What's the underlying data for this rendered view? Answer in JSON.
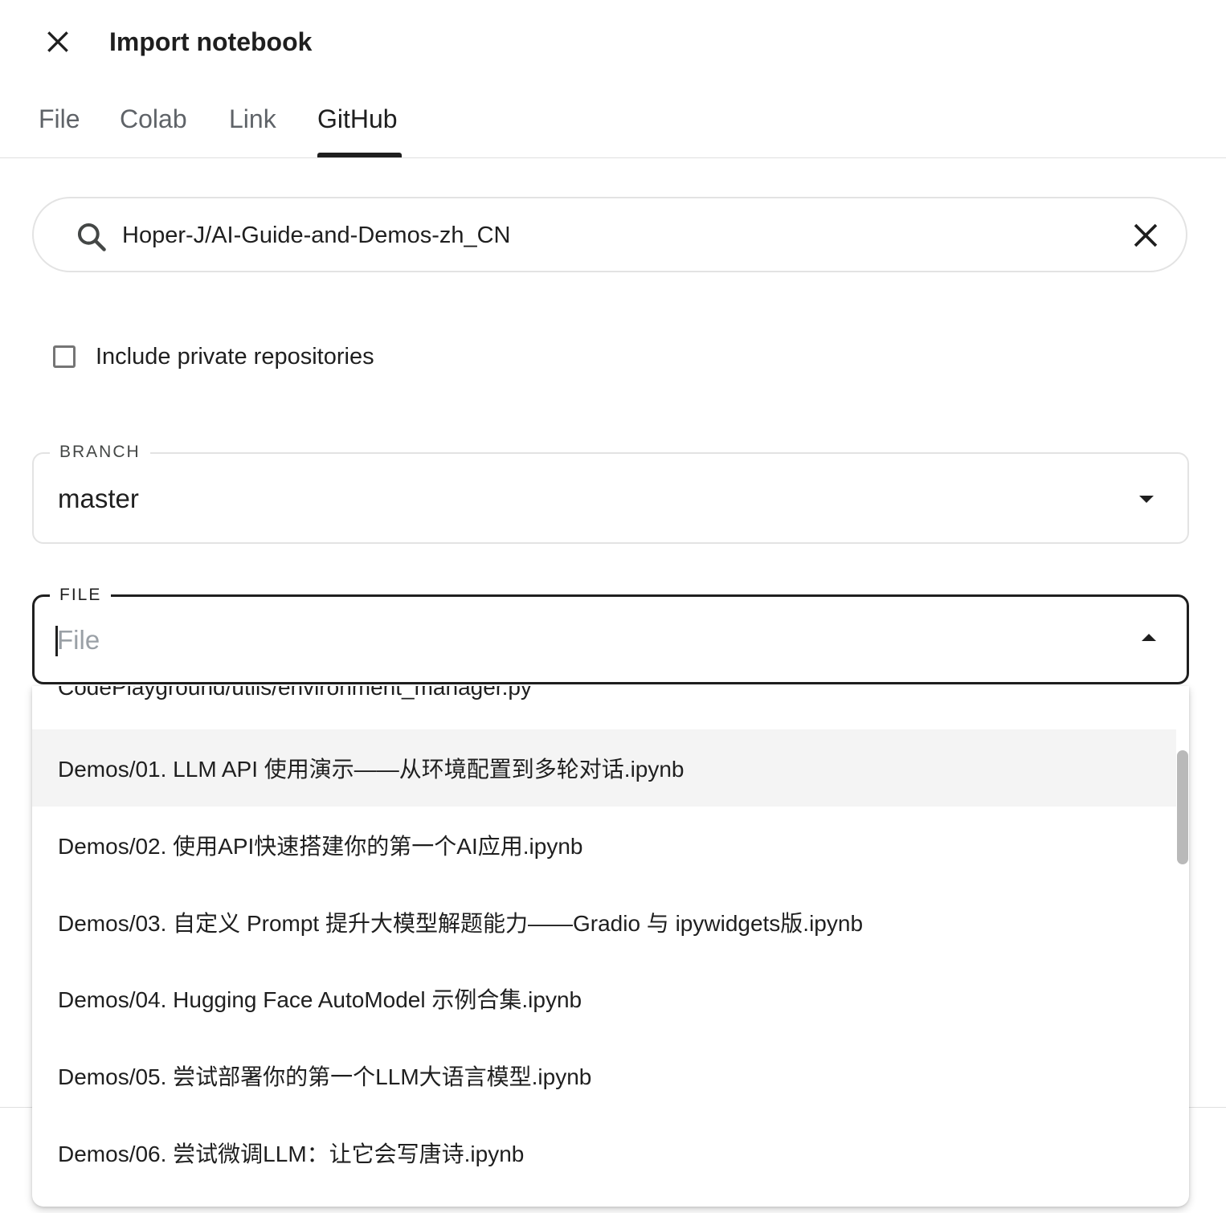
{
  "header": {
    "close_icon": "close-icon",
    "title": "Import notebook"
  },
  "tabs": [
    {
      "label": "File",
      "active": false
    },
    {
      "label": "Colab",
      "active": false
    },
    {
      "label": "Link",
      "active": false
    },
    {
      "label": "GitHub",
      "active": true
    }
  ],
  "search": {
    "icon": "search-icon",
    "value": "Hoper-J/AI-Guide-and-Demos-zh_CN",
    "clear_icon": "close-icon"
  },
  "private_repos": {
    "label": "Include private repositories",
    "checked": false
  },
  "branch": {
    "label": "BRANCH",
    "value": "master"
  },
  "file": {
    "label": "FILE",
    "placeholder": "File",
    "value": ""
  },
  "file_options": [
    {
      "label": "CodePlayground/utils/environment_manager.py"
    },
    {
      "label": "Demos/01. LLM API 使用演示——从环境配置到多轮对话.ipynb",
      "highlighted": true
    },
    {
      "label": "Demos/02. 使用API快速搭建你的第一个AI应用.ipynb"
    },
    {
      "label": "Demos/03. 自定义 Prompt 提升大模型解题能力——Gradio 与 ipywidgets版.ipynb"
    },
    {
      "label": "Demos/04. Hugging Face AutoModel 示例合集.ipynb"
    },
    {
      "label": "Demos/05. 尝试部署你的第一个LLM大语言模型.ipynb"
    },
    {
      "label": "Demos/06. 尝试微调LLM：让它会写唐诗.ipynb"
    }
  ],
  "colors": {
    "text": "#1f1f1f",
    "muted": "#5f6368",
    "border": "#e3e3e3",
    "highlight": "#f4f4f4",
    "scrollbar": "#b9b9b9"
  }
}
